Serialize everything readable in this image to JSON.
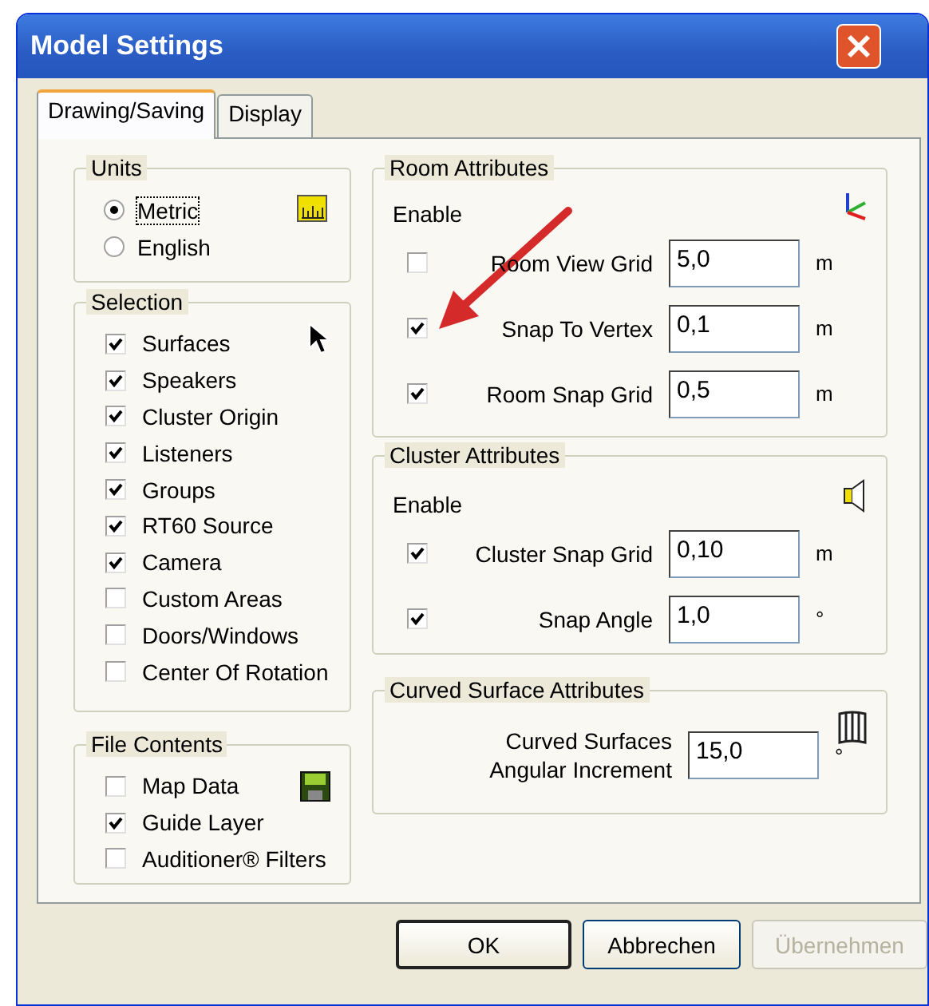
{
  "window": {
    "title": "Model Settings"
  },
  "tabs": [
    {
      "label": "Drawing/Saving",
      "selected": true
    },
    {
      "label": "Display",
      "selected": false
    }
  ],
  "units": {
    "title": "Units",
    "options": [
      {
        "label": "Metric",
        "selected": true
      },
      {
        "label": "English",
        "selected": false
      }
    ]
  },
  "selection": {
    "title": "Selection",
    "items": [
      {
        "label": "Surfaces",
        "checked": true
      },
      {
        "label": "Speakers",
        "checked": true
      },
      {
        "label": "Cluster Origin",
        "checked": true
      },
      {
        "label": "Listeners",
        "checked": true
      },
      {
        "label": "Groups",
        "checked": true
      },
      {
        "label": "RT60 Source",
        "checked": true
      },
      {
        "label": "Camera",
        "checked": true
      },
      {
        "label": "Custom Areas",
        "checked": false
      },
      {
        "label": "Doors/Windows",
        "checked": false
      },
      {
        "label": "Center Of Rotation",
        "checked": false
      }
    ]
  },
  "file_contents": {
    "title": "File Contents",
    "items": [
      {
        "label": "Map Data",
        "checked": false
      },
      {
        "label": "Guide Layer",
        "checked": true
      },
      {
        "label": "Auditioner® Filters",
        "checked": false
      }
    ]
  },
  "room_attributes": {
    "title": "Room Attributes",
    "enable_label": "Enable",
    "rows": [
      {
        "label": "Room View Grid",
        "checked": false,
        "value": "5,0",
        "unit": "m"
      },
      {
        "label": "Snap To Vertex",
        "checked": true,
        "value": "0,1",
        "unit": "m"
      },
      {
        "label": "Room Snap Grid",
        "checked": true,
        "value": "0,5",
        "unit": "m"
      }
    ]
  },
  "cluster_attributes": {
    "title": "Cluster Attributes",
    "enable_label": "Enable",
    "rows": [
      {
        "label": "Cluster Snap Grid",
        "checked": true,
        "value": "0,10",
        "unit": "m"
      },
      {
        "label": "Snap Angle",
        "checked": true,
        "value": "1,0",
        "unit": "°"
      }
    ]
  },
  "curved_surface_attributes": {
    "title": "Curved Surface Attributes",
    "label": "Curved Surfaces Angular Increment",
    "value": "15,0",
    "unit": "°"
  },
  "buttons": [
    {
      "label": "OK",
      "default": true,
      "disabled": false
    },
    {
      "label": "Abbrechen",
      "default": false,
      "disabled": false
    },
    {
      "label": "Übernehmen",
      "default": false,
      "disabled": true
    }
  ]
}
